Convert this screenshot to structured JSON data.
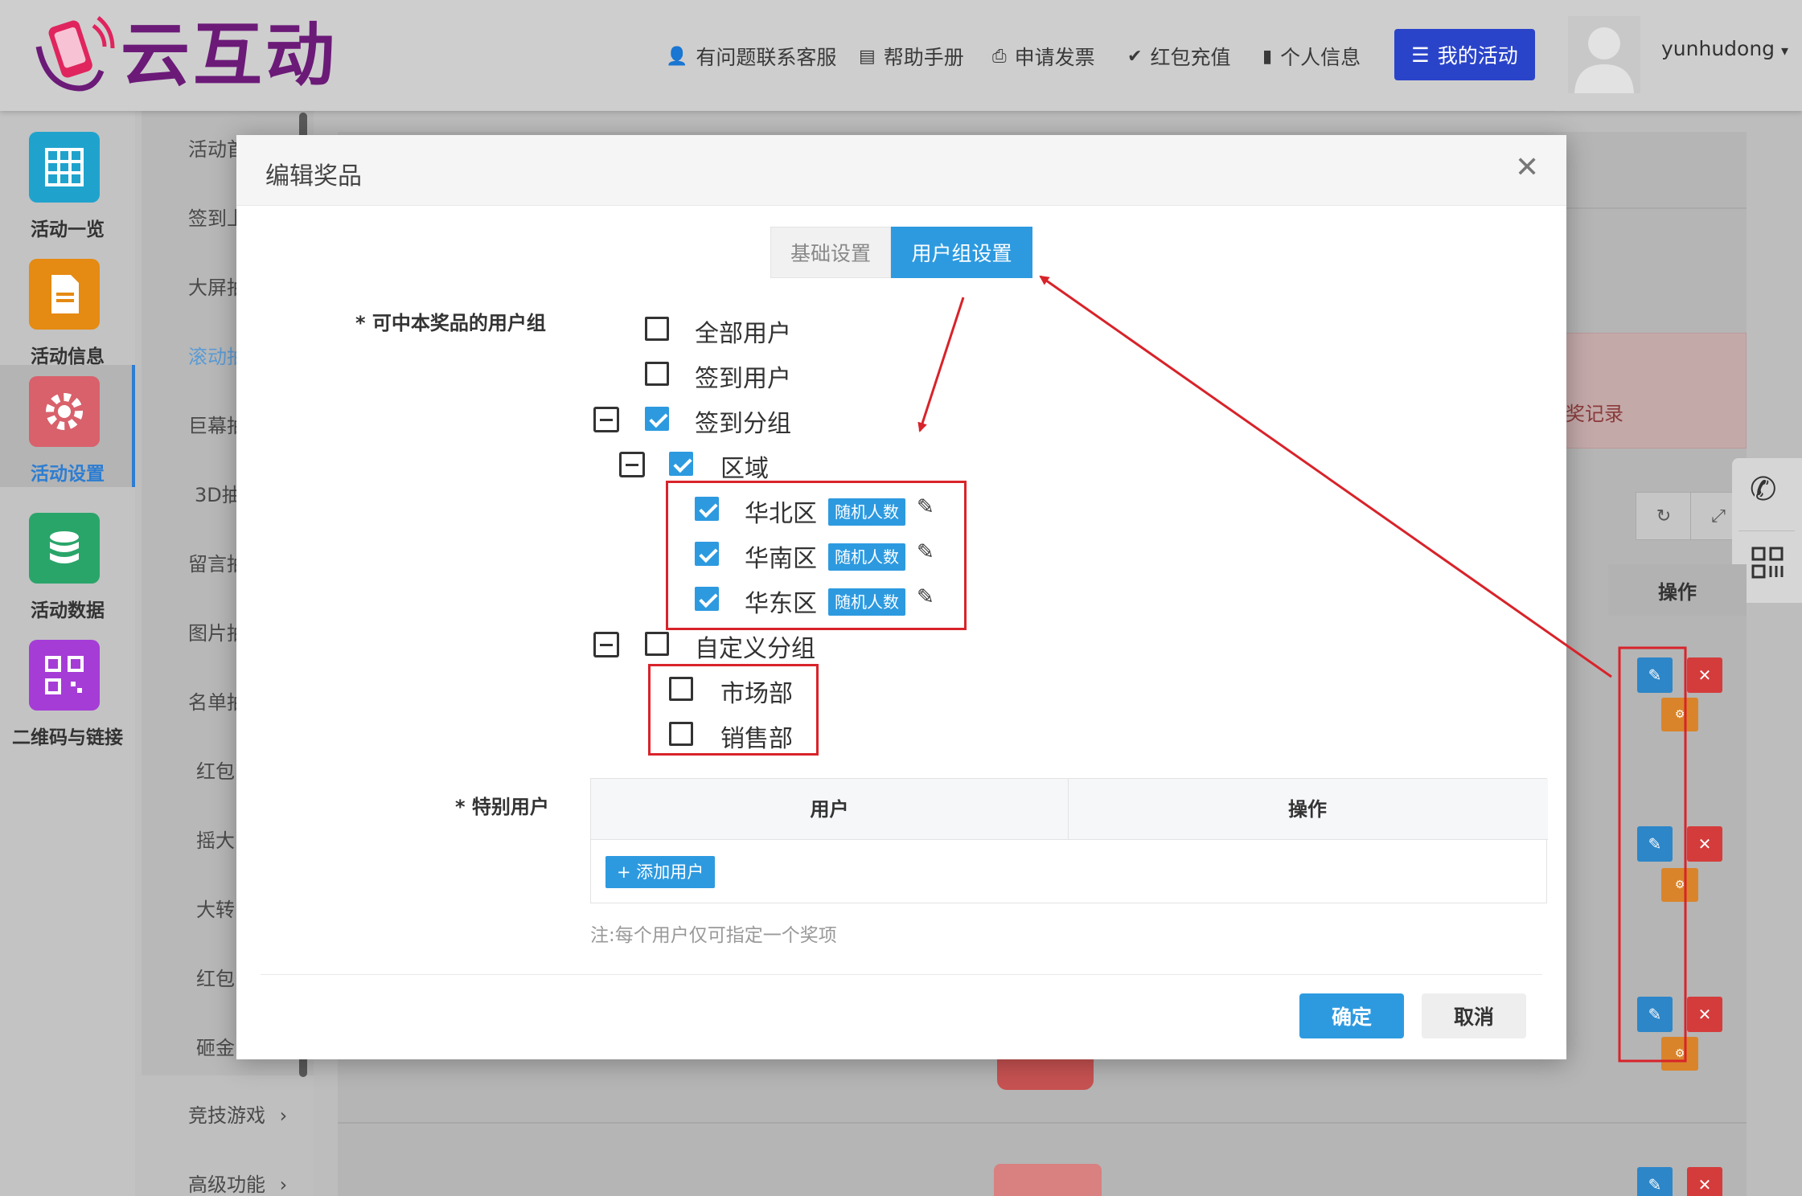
{
  "header": {
    "logo_text": "云互动",
    "nav": [
      {
        "label": "有问题联系客服",
        "icon": "user-plus-icon"
      },
      {
        "label": "帮助手册",
        "icon": "book-icon"
      },
      {
        "label": "申请发票",
        "icon": "printer-icon"
      },
      {
        "label": "红包充值",
        "icon": "shield-check-icon"
      },
      {
        "label": "个人信息",
        "icon": "file-icon"
      }
    ],
    "my_activity": "我的活动",
    "username": "yunhudong"
  },
  "sidebar": {
    "items": [
      {
        "label": "活动一览",
        "color": "#1fa3cd"
      },
      {
        "label": "活动信息",
        "color": "#e58a12"
      },
      {
        "label": "活动设置",
        "color": "#d8616b"
      },
      {
        "label": "活动数据",
        "color": "#2aa56a"
      },
      {
        "label": "二维码与链接",
        "color": "#a53cd6"
      }
    ],
    "active_index": 2
  },
  "submenu": {
    "items": [
      "活动首",
      "签到上",
      "大屏抽",
      "滚动抽",
      "巨幕抽",
      "3D抽",
      "留言抽",
      "图片抽",
      "名单抽",
      "红包",
      "摇大",
      "大转",
      "红包",
      "砸金",
      "竞技游戏",
      "高级功能"
    ]
  },
  "background": {
    "pink_text": "奖记录",
    "op_header": "操作"
  },
  "modal": {
    "title": "编辑奖品",
    "tabs": [
      "基础设置",
      "用户组设置"
    ],
    "active_tab": 1,
    "group_label": "* 可中本奖品的用户组",
    "tree": [
      {
        "label": "全部用户",
        "checked": false
      },
      {
        "label": "签到用户",
        "checked": false
      },
      {
        "label": "签到分组",
        "checked": true
      },
      {
        "label": "区域",
        "checked": true
      },
      {
        "label": "华北区",
        "checked": true,
        "tag": "随机人数"
      },
      {
        "label": "华南区",
        "checked": true,
        "tag": "随机人数"
      },
      {
        "label": "华东区",
        "checked": true,
        "tag": "随机人数"
      },
      {
        "label": "自定义分组",
        "checked": false
      },
      {
        "label": "市场部",
        "checked": false
      },
      {
        "label": "销售部",
        "checked": false
      }
    ],
    "special_label": "* 特别用户",
    "table_headers": [
      "用户",
      "操作"
    ],
    "add_user": "+ 添加用户",
    "note": "注:每个用户仅可指定一个奖项",
    "ok": "确定",
    "cancel": "取消"
  },
  "colors": {
    "accent": "#2d9ae0",
    "annotation": "#d8232a",
    "nav_button": "#2a44c9"
  }
}
